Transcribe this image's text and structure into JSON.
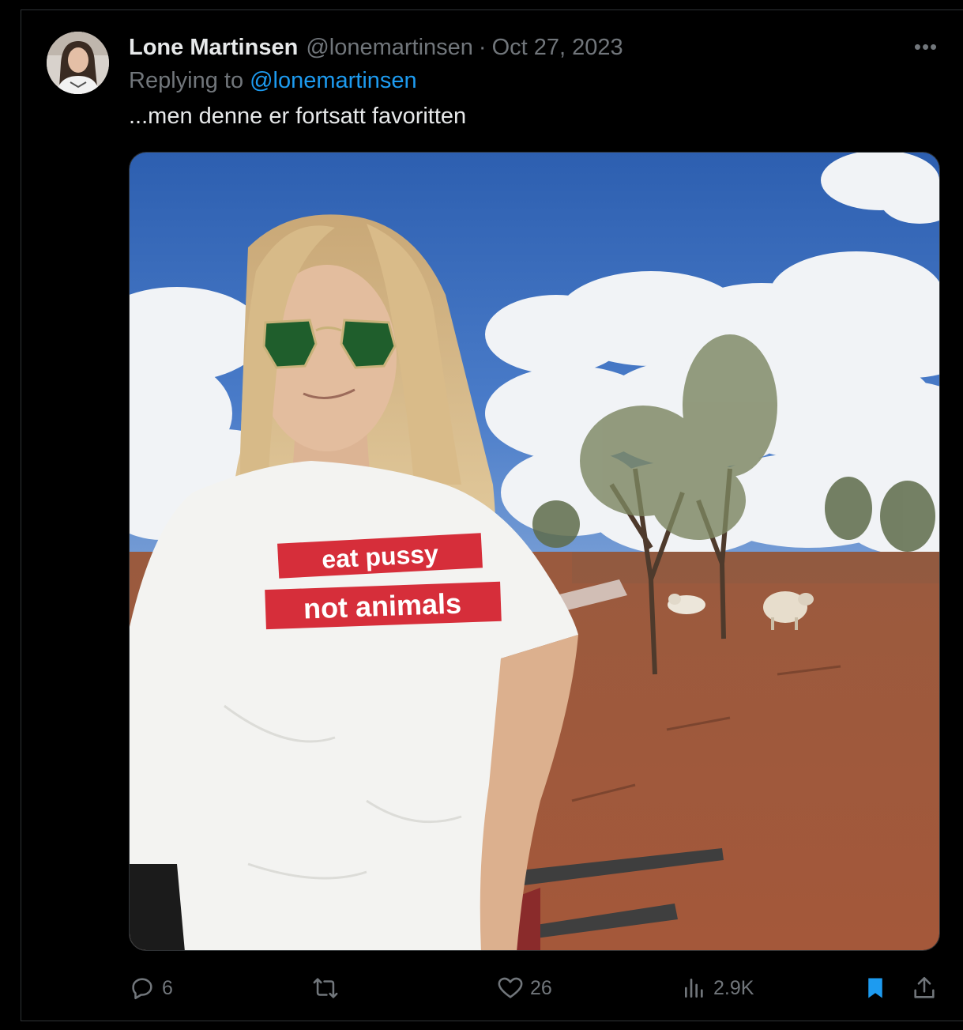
{
  "tweet": {
    "display_name": "Lone Martinsen",
    "handle": "@lonemartinsen",
    "separator": "·",
    "date": "Oct 27, 2023",
    "replying_prefix": "Replying to",
    "replying_to": "@lonemartinsen",
    "text": "...men denne er fortsatt favoritten",
    "more_label": "•••"
  },
  "media": {
    "shirt_line1": "eat pussy",
    "shirt_line2": "not animals"
  },
  "actions": {
    "replies": "6",
    "reposts": "",
    "likes": "26",
    "views": "2.9K"
  },
  "colors": {
    "background": "#000000",
    "text_primary": "#e7e9ea",
    "text_secondary": "#71767b",
    "accent": "#1d9bf0",
    "border": "#2f3336"
  },
  "icons": [
    "reply-icon",
    "repost-icon",
    "like-icon",
    "views-icon",
    "bookmark-icon",
    "share-icon",
    "more-icon"
  ]
}
